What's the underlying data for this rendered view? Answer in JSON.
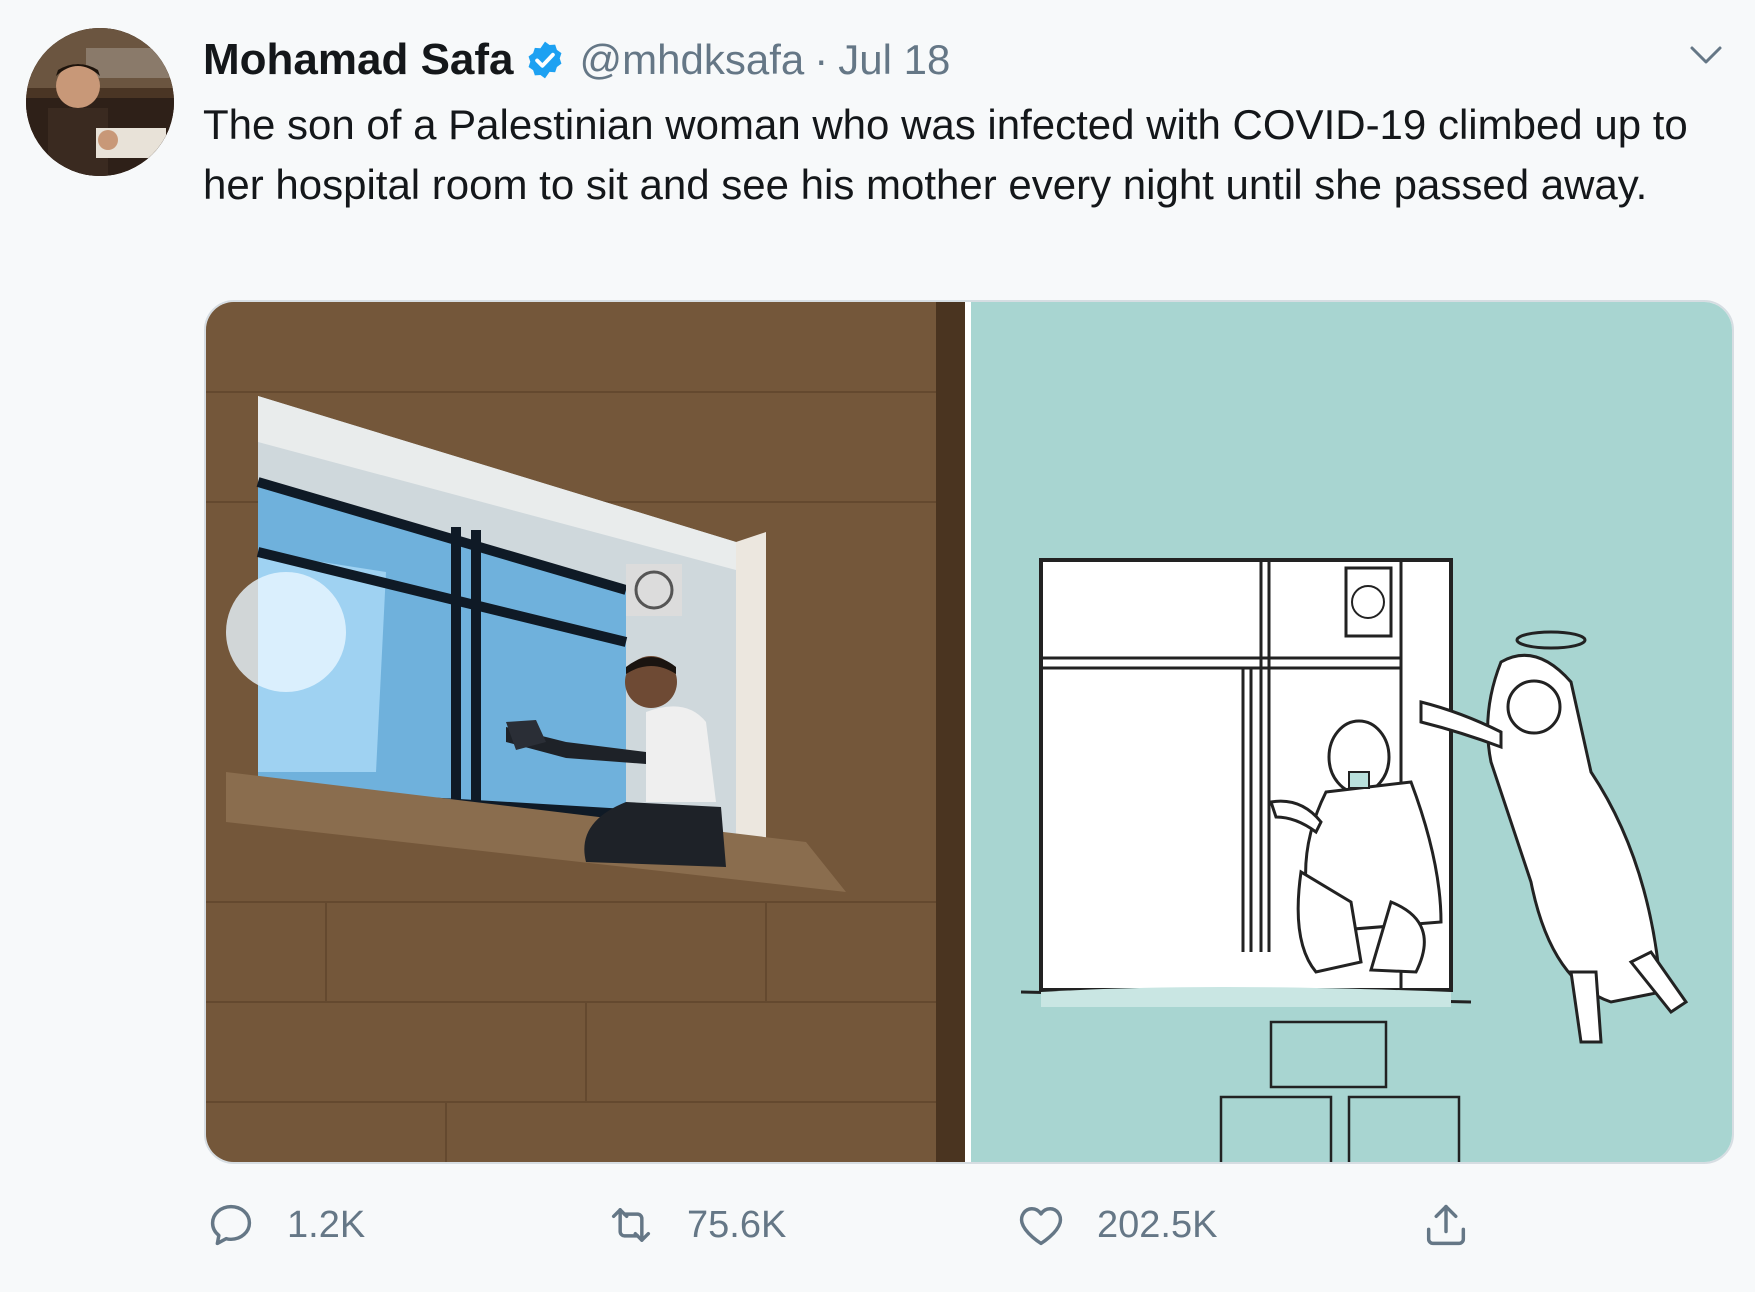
{
  "tweet": {
    "author_name": "Mohamad Safa",
    "handle": "@mhdksafa",
    "separator": "·",
    "date": "Jul 18",
    "text": "The son of a Palestinian woman who was infected with COVID-19 climbed up to her hospital room to sit and see his mother every night until she passed away.",
    "verified": true
  },
  "icons": {
    "more": "chevron-down-icon",
    "verified": "verified-badge-icon",
    "reply": "reply-icon",
    "retweet": "retweet-icon",
    "like": "heart-icon",
    "share": "share-icon"
  },
  "actions": {
    "replies": "1.2K",
    "retweets": "75.6K",
    "likes": "202.5K"
  },
  "colors": {
    "accent": "#1da1f2",
    "secondary_text": "#657786",
    "cartoon_background": "#a8d5d1"
  }
}
